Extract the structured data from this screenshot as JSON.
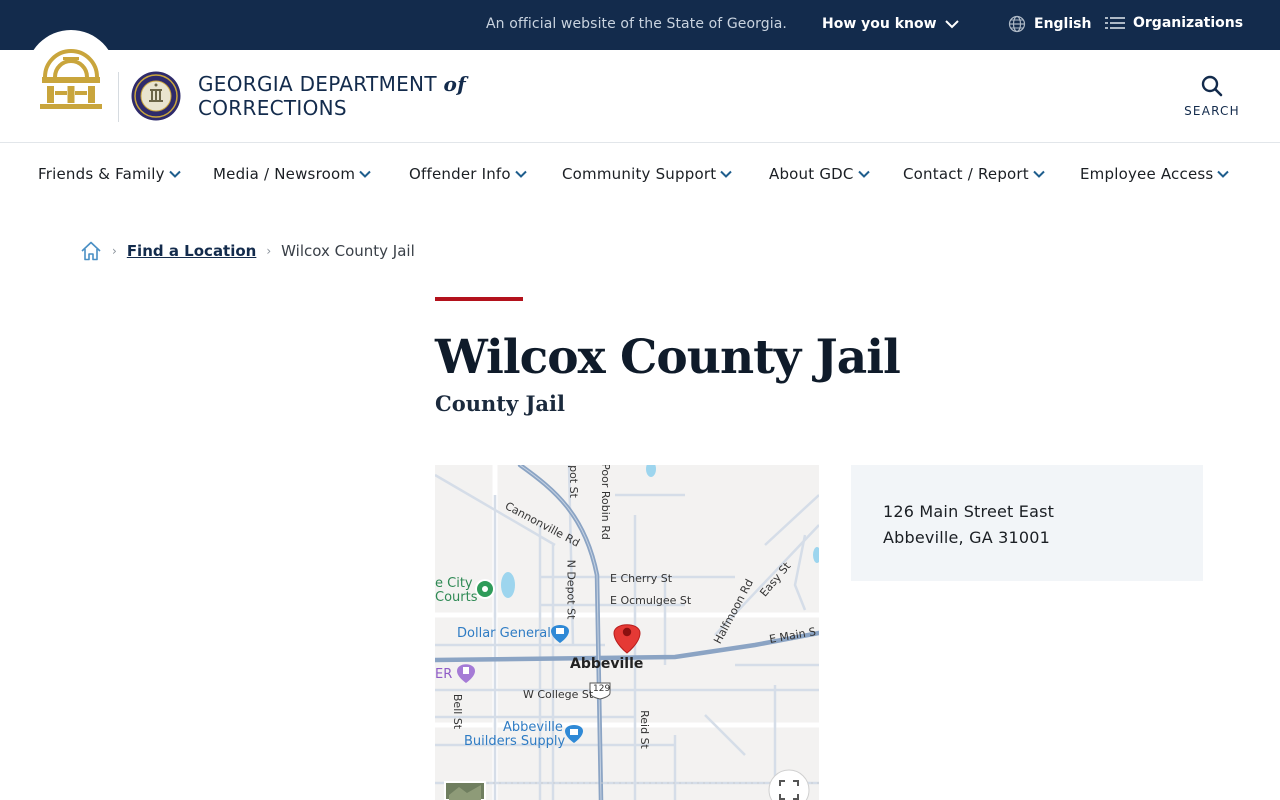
{
  "topbar": {
    "official_text": "An official website of the State of Georgia.",
    "how_you_know": "How you know",
    "language": "English",
    "organizations": "Organizations"
  },
  "header": {
    "brand_line1": "GEORGIA DEPARTMENT",
    "brand_of": "of",
    "brand_line2": "CORRECTIONS",
    "search_label": "SEARCH"
  },
  "nav": {
    "items": [
      {
        "label": "Friends & Family"
      },
      {
        "label": "Media / Newsroom"
      },
      {
        "label": "Offender Info"
      },
      {
        "label": "Community Support"
      },
      {
        "label": "About GDC"
      },
      {
        "label": "Contact / Report"
      },
      {
        "label": "Employee Access"
      }
    ]
  },
  "breadcrumb": {
    "link": "Find a Location",
    "current": "Wilcox County Jail"
  },
  "page": {
    "title": "Wilcox County Jail",
    "subtitle": "County Jail"
  },
  "map": {
    "labels": {
      "cannonville": "Cannonville Rd",
      "poor_robin": "Poor Robin Rd",
      "depot_top": "pot St",
      "n_depot": "N Depot St",
      "e_cherry": "E Cherry St",
      "e_ocmulgee": "E Ocmulgee St",
      "halfmoon": "Halfmoon Rd",
      "easy": "Easy St",
      "e_main": "E Main S",
      "w_college": "W College St",
      "bell": "Bell St",
      "reid": "Reid St",
      "route": "129",
      "town": "Abbeville",
      "city_courts_1": "e City",
      "city_courts_2": "Courts",
      "dollar_general": "Dollar General",
      "builders_1": "Abbeville",
      "builders_2": "Builders Supply",
      "er": "ER"
    }
  },
  "address": {
    "line1": "126 Main Street East",
    "line2": "Abbeville, GA 31001"
  },
  "colors": {
    "navy": "#132b4c",
    "accent_red": "#b3121c",
    "gold": "#c9a53c"
  }
}
